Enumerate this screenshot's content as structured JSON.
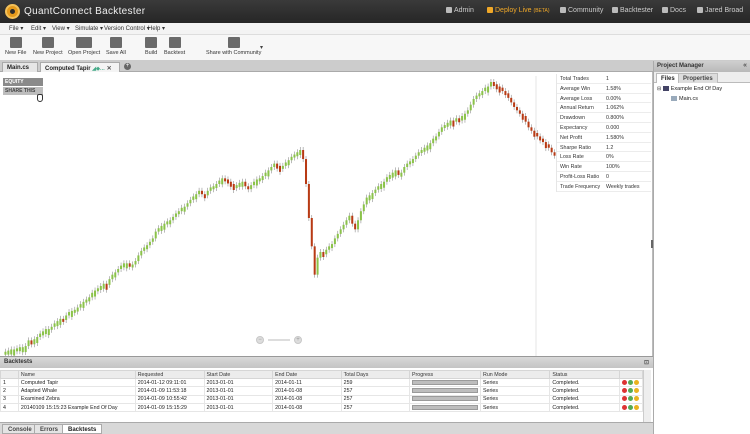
{
  "app": {
    "title": "QuantConnect Backtester"
  },
  "topnav": [
    {
      "label": "Admin",
      "icon": "gear-icon"
    },
    {
      "label": "Deploy Live",
      "badge": "(BETA)",
      "icon": "rocket-icon"
    },
    {
      "label": "Community",
      "icon": "community-icon"
    },
    {
      "label": "Backtester",
      "icon": "backtester-icon"
    },
    {
      "label": "Docs",
      "icon": "docs-icon"
    },
    {
      "label": "Jared Broad",
      "icon": "user-icon"
    }
  ],
  "menu": [
    {
      "label": "File ▾"
    },
    {
      "label": "Edit ▾"
    },
    {
      "label": "View ▾"
    },
    {
      "label": "Simulate ▾"
    },
    {
      "label": "Version Control ▾"
    },
    {
      "label": "Help ▾"
    }
  ],
  "toolbar": [
    {
      "label": "New File",
      "icon": "new-file-icon"
    },
    {
      "label": "New Project",
      "icon": "new-project-icon"
    },
    {
      "label": "Open Project",
      "icon": "open-folder-icon"
    },
    {
      "label": "Save All",
      "icon": "save-icon"
    },
    {
      "label": "Build",
      "icon": "build-gears-icon"
    },
    {
      "label": "Backtest",
      "icon": "backtest-chart-icon"
    },
    {
      "label": "Share with Community",
      "icon": "share-icon"
    }
  ],
  "editor_tabs": [
    {
      "label": "Main.cs"
    },
    {
      "label": "Computed Tapir"
    }
  ],
  "chart": {
    "equity_label": "EQUITY",
    "share_label": "SHARE THIS",
    "up_color": "#8bc34a",
    "down_color": "#b83a14"
  },
  "chart_data": {
    "type": "candlestick",
    "title": "",
    "xlabel": "",
    "ylabel": "",
    "values": [
      2,
      3,
      4,
      4,
      5,
      6,
      6,
      7,
      12,
      11,
      13,
      15,
      18,
      20,
      22,
      22,
      24,
      27,
      29,
      31,
      30,
      34,
      37,
      38,
      39,
      41,
      44,
      46,
      48,
      50,
      54,
      56,
      58,
      60,
      62,
      61,
      66,
      70,
      72,
      75,
      78,
      80,
      80,
      77,
      79,
      82,
      87,
      91,
      94,
      96,
      99,
      102,
      108,
      111,
      113,
      115,
      117,
      118,
      121,
      124,
      126,
      129,
      130,
      133,
      136,
      139,
      141,
      144,
      141,
      140,
      144,
      147,
      148,
      150,
      153,
      155,
      154,
      152,
      150,
      148,
      149,
      151,
      152,
      148,
      147,
      149,
      152,
      154,
      155,
      157,
      160,
      162,
      165,
      168,
      166,
      164,
      166,
      169,
      171,
      174,
      176,
      178,
      180,
      172,
      150,
      120,
      95,
      70,
      85,
      90,
      88,
      92,
      95,
      97,
      102,
      106,
      110,
      114,
      118,
      122,
      115,
      110,
      118,
      126,
      132,
      138,
      140,
      142,
      145,
      148,
      150,
      152,
      156,
      158,
      160,
      162,
      158,
      160,
      165,
      168,
      170,
      172,
      175,
      178,
      180,
      182,
      184,
      186,
      190,
      192,
      196,
      200,
      202,
      204,
      206,
      205,
      208,
      206,
      210,
      212,
      215,
      220,
      225,
      228,
      230,
      232,
      235,
      236,
      240,
      238,
      236,
      235,
      232,
      230,
      226,
      222,
      218,
      215,
      212,
      210,
      205,
      200,
      197,
      195,
      192,
      190,
      187,
      185,
      182,
      178,
      175
    ]
  },
  "stats": [
    {
      "label": "Total Trades",
      "value": "1"
    },
    {
      "label": "Average Win",
      "value": "1.58%"
    },
    {
      "label": "Average Loss",
      "value": "0.00%"
    },
    {
      "label": "Annual Return",
      "value": "1.062%"
    },
    {
      "label": "Drawdown",
      "value": "0.800%"
    },
    {
      "label": "Expectancy",
      "value": "0.000"
    },
    {
      "label": "Net Profit",
      "value": "1.580%"
    },
    {
      "label": "Sharpe Ratio",
      "value": "1.2"
    },
    {
      "label": "Loss Rate",
      "value": "0%"
    },
    {
      "label": "Win Rate",
      "value": "100%"
    },
    {
      "label": "Profit-Loss Ratio",
      "value": "0"
    },
    {
      "label": "Trade Frequency",
      "value": "Weekly trades"
    }
  ],
  "project_manager": {
    "title": "Project Manager",
    "tabs": [
      "Files",
      "Properties"
    ],
    "tree_root": "Example End Of Day",
    "tree_file": "Main.cs"
  },
  "backtests": {
    "title": "Backtests",
    "columns": [
      "",
      "Name",
      "Requested",
      "Start Date",
      "End Date",
      "Total Days",
      "Progress",
      "Run Mode",
      "Status"
    ],
    "rows": [
      {
        "idx": "1",
        "name": "Computed Tapir",
        "requested": "2014-01-12 09:11:01",
        "start": "2013-01-01",
        "end": "2014-01-11",
        "days": "259",
        "progress": 1.0,
        "mode": "Series",
        "status": "Completed."
      },
      {
        "idx": "2",
        "name": "Adapted Whale",
        "requested": "2014-01-09 11:53:18",
        "start": "2013-01-01",
        "end": "2014-01-08",
        "days": "257",
        "progress": 1.0,
        "mode": "Series",
        "status": "Completed."
      },
      {
        "idx": "3",
        "name": "Examined Zebra",
        "requested": "2014-01-09 10:55:42",
        "start": "2013-01-01",
        "end": "2014-01-08",
        "days": "257",
        "progress": 1.0,
        "mode": "Series",
        "status": "Completed."
      },
      {
        "idx": "4",
        "name": "20140109 15:15:23 Example End Of Day",
        "requested": "2014-01-09 15:15:29",
        "start": "2013-01-01",
        "end": "2014-01-08",
        "days": "257",
        "progress": 1.0,
        "mode": "Series",
        "status": "Completed."
      }
    ]
  },
  "bottom_tabs": [
    {
      "label": "Console"
    },
    {
      "label": "Errors"
    },
    {
      "label": "Backtests"
    }
  ]
}
